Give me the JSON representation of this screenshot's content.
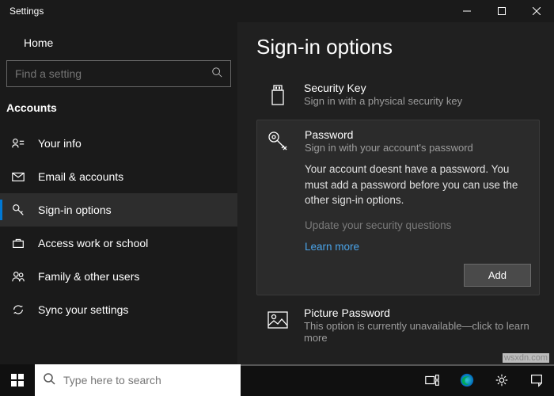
{
  "titlebar": {
    "title": "Settings"
  },
  "sidebar": {
    "home": "Home",
    "search_placeholder": "Find a setting",
    "category": "Accounts",
    "items": [
      {
        "label": "Your info"
      },
      {
        "label": "Email & accounts"
      },
      {
        "label": "Sign-in options"
      },
      {
        "label": "Access work or school"
      },
      {
        "label": "Family & other users"
      },
      {
        "label": "Sync your settings"
      }
    ]
  },
  "content": {
    "heading": "Sign-in options",
    "security_key": {
      "title": "Security Key",
      "sub": "Sign in with a physical security key"
    },
    "password": {
      "title": "Password",
      "sub": "Sign in with your account's password",
      "detail": "Your account doesnt have a password. You must add a password before you can use the other sign-in options.",
      "update_q": "Update your security questions",
      "learn": "Learn more",
      "add_btn": "Add"
    },
    "picture_pw": {
      "title": "Picture Password",
      "sub": "This option is currently unavailable—click to learn more"
    }
  },
  "taskbar": {
    "search_placeholder": "Type here to search"
  },
  "watermark": "wsxdn.com"
}
